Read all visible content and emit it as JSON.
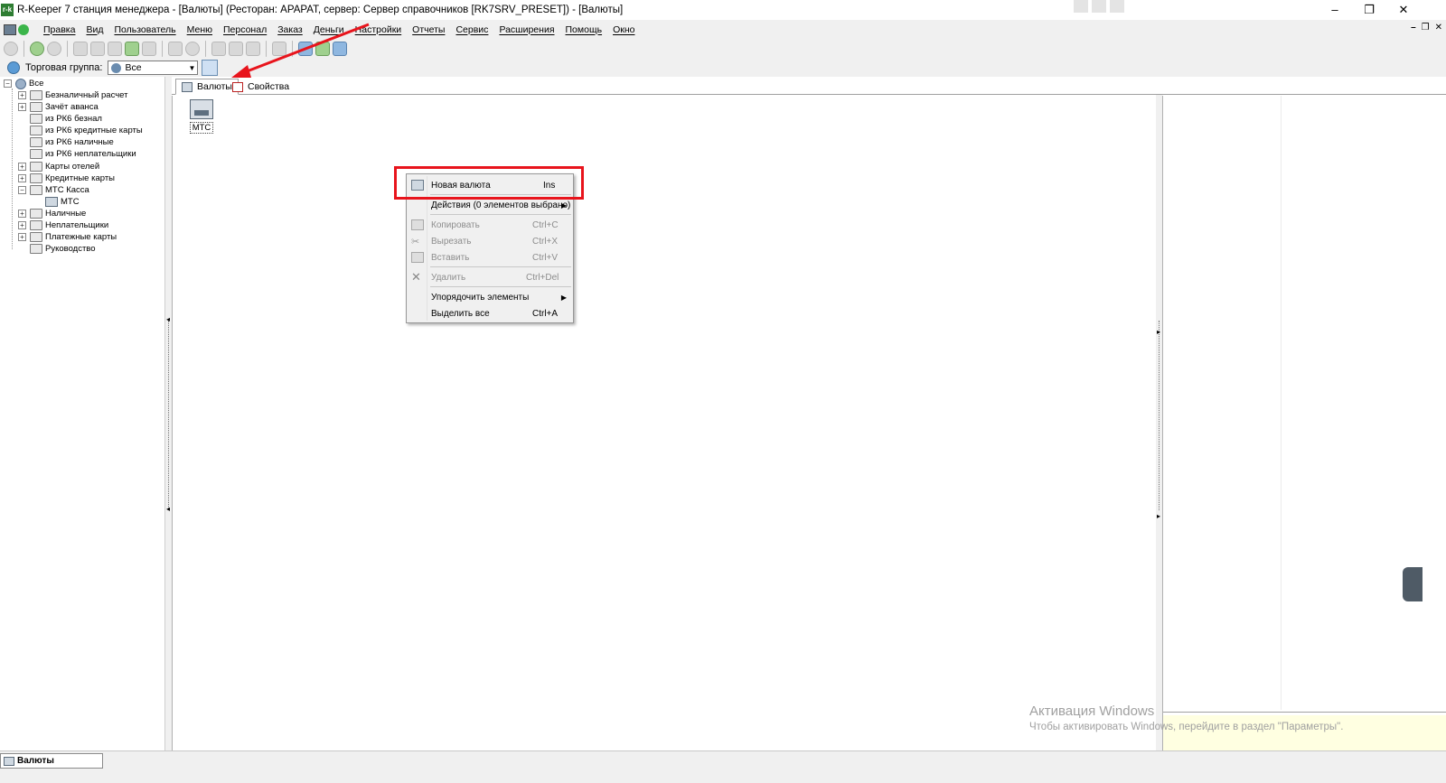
{
  "window": {
    "logo_text": "r-k",
    "title": "R-Keeper 7 станция менеджера - [Валюты] (Ресторан: АРАРАТ, сервер: Сервер справочников [RK7SRV_PRESET]) - [Валюты]",
    "minimize": "–",
    "restore": "❐",
    "close": "✕"
  },
  "menubar": {
    "items": [
      "Правка",
      "Вид",
      "Пользователь",
      "Меню",
      "Персонал",
      "Заказ",
      "Деньги",
      "Настройки",
      "Отчеты",
      "Сервис",
      "Расширения",
      "Помощь",
      "Окно"
    ],
    "mdi_minimize": "–",
    "mdi_restore": "❐",
    "mdi_close": "✕"
  },
  "filter": {
    "label": "Торговая группа:",
    "selected": "Все"
  },
  "tree": {
    "root": "Все",
    "items": [
      {
        "label": "Безналичный расчет",
        "expandable": true
      },
      {
        "label": "Зачёт аванса",
        "expandable": true
      },
      {
        "label": "из РК6 безнал",
        "expandable": false
      },
      {
        "label": "из РК6 кредитные карты",
        "expandable": false
      },
      {
        "label": "из РК6 наличные",
        "expandable": false
      },
      {
        "label": "из РК6 неплательщики",
        "expandable": false
      },
      {
        "label": "Карты отелей",
        "expandable": true
      },
      {
        "label": "Кредитные карты",
        "expandable": true
      },
      {
        "label": "МТС Касса",
        "expandable": true,
        "expanded": true
      },
      {
        "label": "МТС",
        "child": true
      },
      {
        "label": "Наличные",
        "expandable": true
      },
      {
        "label": "Неплательщики",
        "expandable": true
      },
      {
        "label": "Платежные карты",
        "expandable": true
      },
      {
        "label": "Руководство",
        "expandable": false
      }
    ]
  },
  "tabs": [
    {
      "label": "Валюты",
      "active": true
    },
    {
      "label": "Свойства",
      "active": false
    }
  ],
  "content": {
    "item_label": "МТС"
  },
  "context_menu": {
    "items": [
      {
        "label": "Новая валюта",
        "shortcut": "Ins",
        "enabled": true,
        "icon": "new-currency-icon"
      },
      {
        "label": "Действия (0 элементов выбрано)",
        "shortcut": "",
        "enabled": true,
        "submenu": true
      },
      {
        "label": "Копировать",
        "shortcut": "Ctrl+C",
        "enabled": false,
        "icon": "copy-icon"
      },
      {
        "label": "Вырезать",
        "shortcut": "Ctrl+X",
        "enabled": false,
        "icon": "cut-icon"
      },
      {
        "label": "Вставить",
        "shortcut": "Ctrl+V",
        "enabled": false,
        "icon": "paste-icon"
      },
      {
        "label": "Удалить",
        "shortcut": "Ctrl+Del",
        "enabled": false,
        "icon": "delete-icon"
      },
      {
        "label": "Упорядочить элементы",
        "shortcut": "",
        "enabled": true,
        "submenu": true
      },
      {
        "label": "Выделить все",
        "shortcut": "Ctrl+A",
        "enabled": true
      }
    ],
    "submenu_arrow": "▶"
  },
  "watermark": {
    "title": "Активация Windows",
    "text": "Чтобы активировать Windows, перейдите в раздел \"Параметры\"."
  },
  "statusbar": {
    "task_label": "Валюты"
  },
  "colors": {
    "highlight": "#e8141c",
    "arrow": "#e8141c"
  }
}
